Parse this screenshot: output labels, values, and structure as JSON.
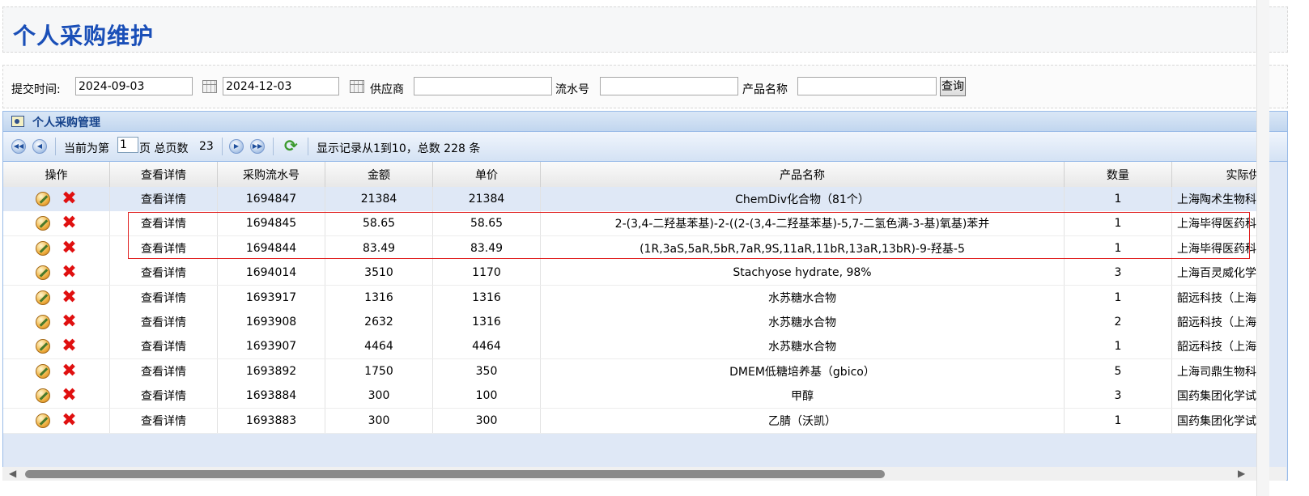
{
  "page": {
    "title": "个人采购维护"
  },
  "filters": {
    "submit_time_label": "提交时间:",
    "start_date": "2024-09-03",
    "end_date": "2024-12-03",
    "supplier_label": "供应商",
    "supplier_value": "",
    "serial_label": "流水号",
    "serial_value": "",
    "product_label": "产品名称",
    "product_value": "",
    "query_button": "查询"
  },
  "panel": {
    "title": "个人采购管理"
  },
  "pager": {
    "current_prefix": "当前为第",
    "current_page": "1",
    "page_suffix": "页 总页数",
    "total_pages": "23",
    "record_info": "显示记录从1到10，总数 228 条"
  },
  "grid": {
    "columns": [
      "操作",
      "查看详情",
      "采购流水号",
      "金额",
      "单价",
      "产品名称",
      "数量",
      "实际供"
    ],
    "rows": [
      {
        "detail": "查看详情",
        "serial": "1694847",
        "amount": "21384",
        "unit_price": "21384",
        "product": "ChemDiv化合物（81个）",
        "qty": "1",
        "supplier": "上海陶术生物科"
      },
      {
        "detail": "查看详情",
        "serial": "1694845",
        "amount": "58.65",
        "unit_price": "58.65",
        "product": "2-(3,4-二羟基苯基)-2-((2-(3,4-二羟基苯基)-5,7-二氢色满-3-基)氧基)苯并",
        "qty": "1",
        "supplier": "上海毕得医药科"
      },
      {
        "detail": "查看详情",
        "serial": "1694844",
        "amount": "83.49",
        "unit_price": "83.49",
        "product": "(1R,3aS,5aR,5bR,7aR,9S,11aR,11bR,13aR,13bR)-9-羟基-5",
        "qty": "1",
        "supplier": "上海毕得医药科"
      },
      {
        "detail": "查看详情",
        "serial": "1694014",
        "amount": "3510",
        "unit_price": "1170",
        "product": "Stachyose hydrate, 98%",
        "qty": "3",
        "supplier": "上海百灵威化学"
      },
      {
        "detail": "查看详情",
        "serial": "1693917",
        "amount": "1316",
        "unit_price": "1316",
        "product": "水苏糖水合物",
        "qty": "1",
        "supplier": "韶远科技（上海"
      },
      {
        "detail": "查看详情",
        "serial": "1693908",
        "amount": "2632",
        "unit_price": "1316",
        "product": "水苏糖水合物",
        "qty": "2",
        "supplier": "韶远科技（上海"
      },
      {
        "detail": "查看详情",
        "serial": "1693907",
        "amount": "4464",
        "unit_price": "4464",
        "product": "水苏糖水合物",
        "qty": "1",
        "supplier": "韶远科技（上海"
      },
      {
        "detail": "查看详情",
        "serial": "1693892",
        "amount": "1750",
        "unit_price": "350",
        "product": "DMEM低糖培养基（gbico）",
        "qty": "5",
        "supplier": "上海司鼎生物科"
      },
      {
        "detail": "查看详情",
        "serial": "1693884",
        "amount": "300",
        "unit_price": "100",
        "product": "甲醇",
        "qty": "3",
        "supplier": "国药集团化学试"
      },
      {
        "detail": "查看详情",
        "serial": "1693883",
        "amount": "300",
        "unit_price": "300",
        "product": "乙腈（沃凯）",
        "qty": "1",
        "supplier": "国药集团化学试"
      }
    ]
  }
}
